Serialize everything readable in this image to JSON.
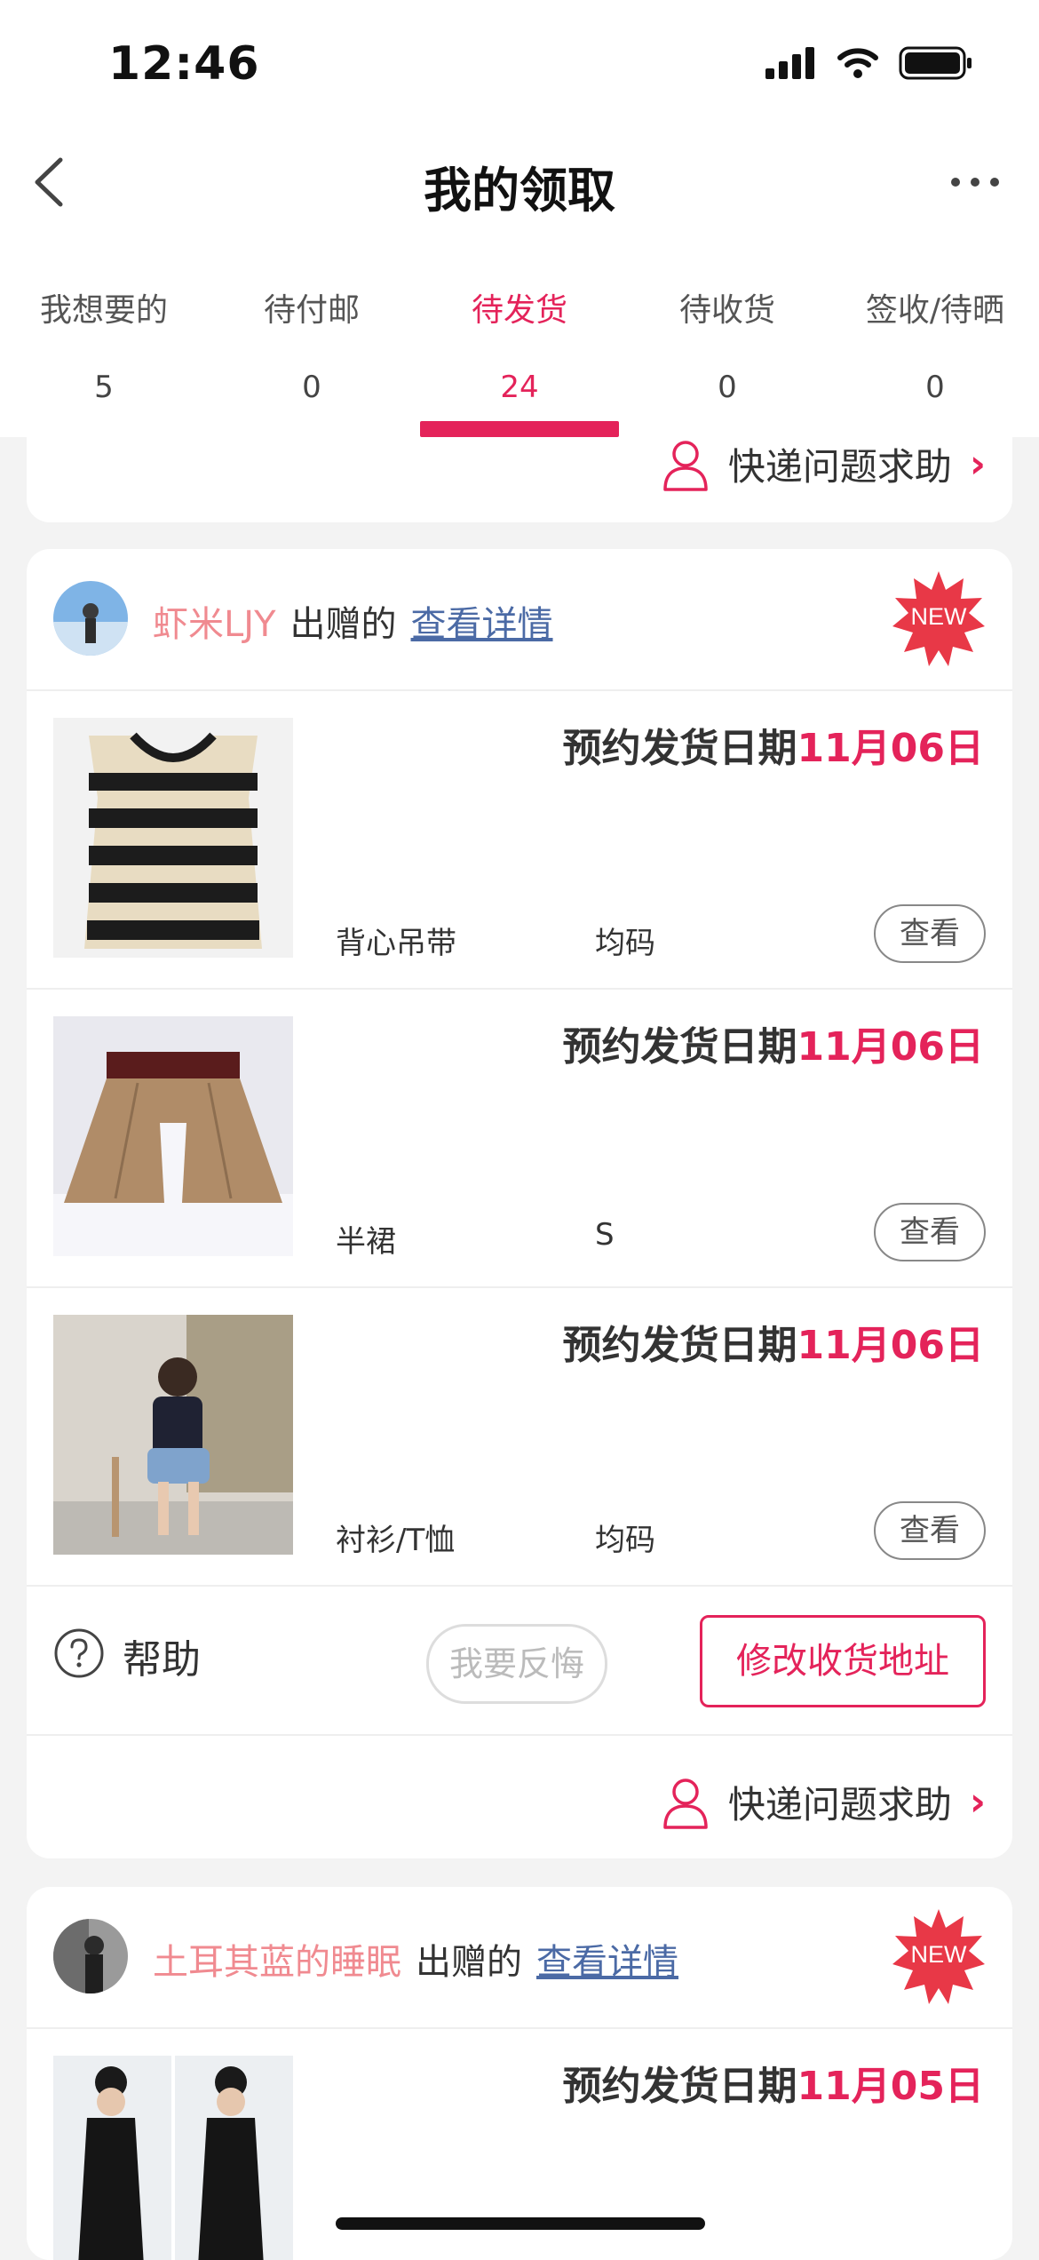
{
  "status_bar": {
    "time": "12:46"
  },
  "nav": {
    "title": "我的领取"
  },
  "tabs": [
    {
      "label": "我想要的",
      "count": "5"
    },
    {
      "label": "待付邮",
      "count": "0"
    },
    {
      "label": "待发货",
      "count": "24",
      "active": true
    },
    {
      "label": "待收货",
      "count": "0"
    },
    {
      "label": "签收/待晒",
      "count": "0"
    }
  ],
  "colors": {
    "accent": "#e4235a",
    "giver_name": "#f08a90",
    "link": "#4b6aa5"
  },
  "courier_help": "快递问题求助",
  "orders": [
    {
      "giver_name": "虾米LJY",
      "giver_verb": "出赠的",
      "detail_link": "查看详情",
      "badge": "NEW",
      "items": [
        {
          "ship_prefix": "预约发货日期",
          "ship_date": "11月06日",
          "category": "背心吊带",
          "size": "均码",
          "view": "查看"
        },
        {
          "ship_prefix": "预约发货日期",
          "ship_date": "11月06日",
          "category": "半裙",
          "size": "S",
          "view": "查看"
        },
        {
          "ship_prefix": "预约发货日期",
          "ship_date": "11月06日",
          "category": "衬衫/T恤",
          "size": "均码",
          "view": "查看"
        }
      ],
      "help_label": "帮助",
      "regret_label": "我要反悔",
      "address_label": "修改收货地址"
    },
    {
      "giver_name": "土耳其蓝的睡眠",
      "giver_verb": "出赠的",
      "detail_link": "查看详情",
      "badge": "NEW",
      "items": [
        {
          "ship_prefix": "预约发货日期",
          "ship_date": "11月05日"
        }
      ]
    }
  ]
}
